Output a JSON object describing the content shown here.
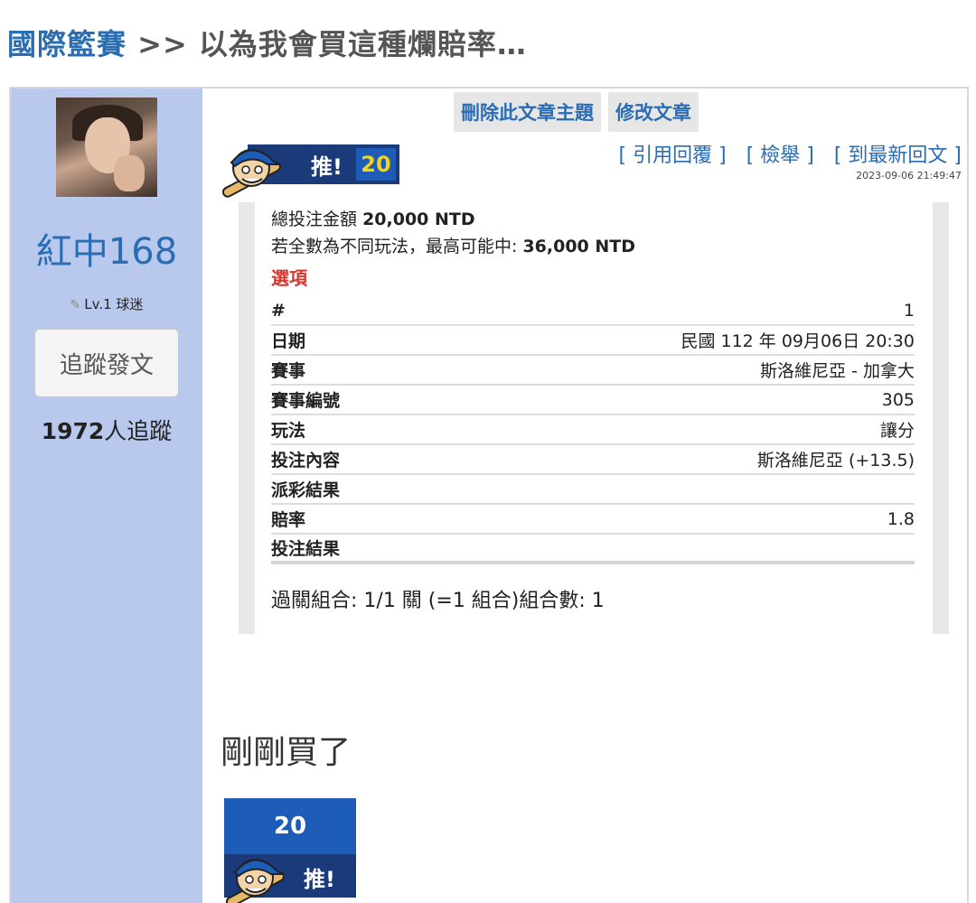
{
  "header": {
    "forum": "國際籃賽",
    "separator": ">>",
    "subject": "以為我會買這種爛賠率…"
  },
  "user": {
    "name": "紅中168",
    "level": "Lv.1 球迷",
    "follow_label": "追蹤發文",
    "follower_count": "1972",
    "follower_suffix": "人追蹤"
  },
  "admin": {
    "delete_label": "刪除此文章主題",
    "edit_label": "修改文章"
  },
  "push": {
    "label": "推!",
    "count": "20"
  },
  "post_links": {
    "quote": "[ 引用回覆 ]",
    "report": "[ 檢舉 ]",
    "latest": "[ 到最新回文 ]"
  },
  "timestamp": "2023-09-06 21:49:47",
  "bet": {
    "total_label": "總投注金額",
    "total_value": "20,000 NTD",
    "max_label": "若全數為不同玩法，最高可能中:",
    "max_value": "36,000 NTD",
    "options_title": "選項",
    "rows": [
      {
        "key": "#",
        "value": "1"
      },
      {
        "key": "日期",
        "value": "民國 112 年 09月06日 20:30"
      },
      {
        "key": "賽事",
        "value": "斯洛維尼亞 - 加拿大"
      },
      {
        "key": "賽事編號",
        "value": "305"
      },
      {
        "key": "玩法",
        "value": "讓分"
      },
      {
        "key": "投注內容",
        "value": "斯洛維尼亞 (+13.5)"
      },
      {
        "key": "派彩結果",
        "value": ""
      },
      {
        "key": "賠率",
        "value": "1.8"
      },
      {
        "key": "投注結果",
        "value": ""
      }
    ],
    "combo": "過關組合: 1/1 關 (=1 組合)組合數: 1"
  },
  "message": "剛剛買了",
  "colors": {
    "link_blue": "#2a6db2",
    "sidebar_bg": "#b9c9ee",
    "push_dark": "#1a3a7a",
    "push_blue": "#1d5cb8",
    "push_count": "#f2d21a",
    "options_red": "#d9342b"
  }
}
